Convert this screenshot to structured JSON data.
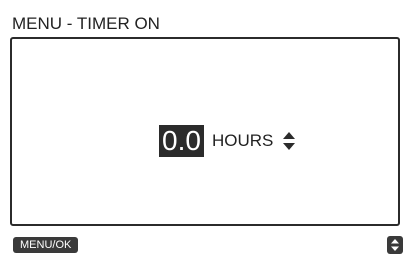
{
  "header": {
    "title": "MENU - TIMER ON"
  },
  "timer": {
    "value": "0.0",
    "unit": "HOURS",
    "adjust_icon": "up-down-arrows-icon"
  },
  "footer": {
    "menu_ok_label": "MENU/OK",
    "scroll_icon": "up-down-arrows-icon"
  },
  "colors": {
    "foreground": "#2b2b2b",
    "background": "#ffffff",
    "highlight_text": "#ffffff"
  }
}
